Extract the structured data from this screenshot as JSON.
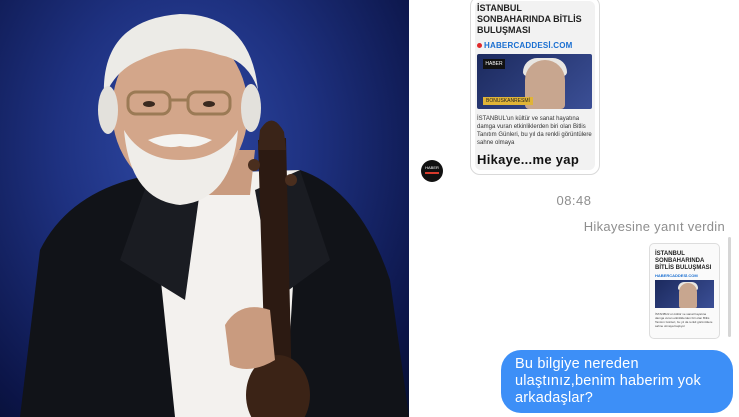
{
  "photo": {
    "icon": "portrait-photo"
  },
  "story_card": {
    "title": "İSTANBUL SONBAHARINDA BİTLİS BULUŞMASI",
    "source": "HABERCADDESİ.COM",
    "thumb_logo": "HABER",
    "thumb_tag": "BONUSKANRESMİ",
    "body": "İSTANBUL'un kültür ve sanat hayatına damga vuran etkinliklerden biri olan Bitlis Tanıtım Günleri, bu yıl da renkli görüntülere sahne olmaya",
    "caption": "Hikaye...me yap"
  },
  "avatar": {
    "label": "HABER",
    "icon": "channel-avatar"
  },
  "timestamp": "08:48",
  "reply_note": "Hikayesine yanıt verdin",
  "reply_preview": {
    "title": "İSTANBUL SONBAHARINDA BİTLİS BULUŞMASI",
    "source": "HABERCADDESİ.COM",
    "body": "İSTANBUL'un kültür ve sanat hayatına damga vuran etkinliklerden biri olan Bitlis Tanıtım Günleri, bu yıl da renkli görüntülere sahne olmaya başlıyor"
  },
  "message": {
    "text": "Bu bilgiye nereden ulaştınız,benim haberim yok arkadaşlar?",
    "bubble_color": "#3d8ff7"
  },
  "colors": {
    "chat_bg": "#ffffff",
    "meta_text": "#8e8e8e",
    "photo_bg": "#1e3180"
  }
}
